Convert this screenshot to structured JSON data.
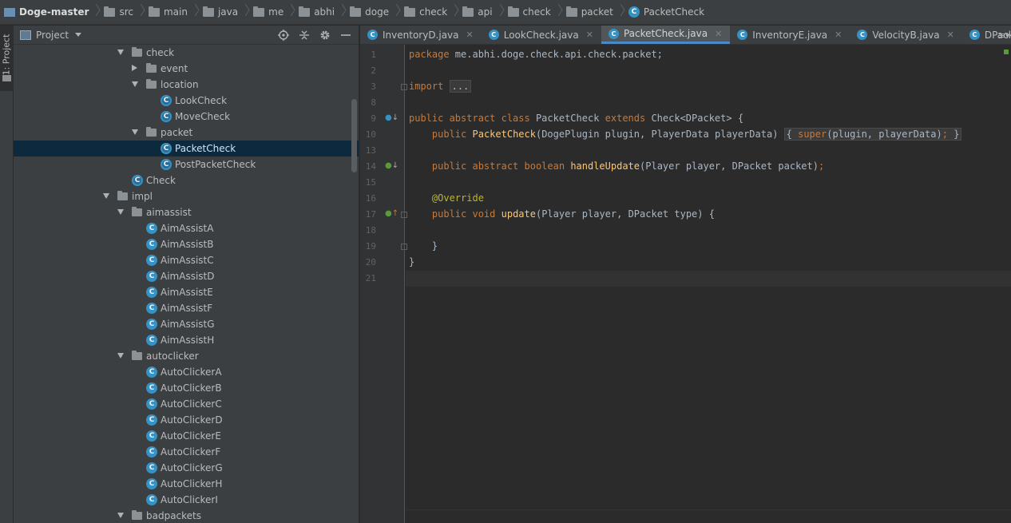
{
  "breadcrumbs": [
    "Doge-master",
    "src",
    "main",
    "java",
    "me",
    "abhi",
    "doge",
    "check",
    "api",
    "check",
    "packet",
    "PacketCheck"
  ],
  "stripe": {
    "tab_label": "1: Project"
  },
  "project_panel": {
    "title": "Project"
  },
  "tree": [
    {
      "label": "check",
      "depth": 2,
      "type": "folder",
      "expanded": true
    },
    {
      "label": "event",
      "depth": 3,
      "type": "folder",
      "expanded": false
    },
    {
      "label": "location",
      "depth": 3,
      "type": "folder",
      "expanded": true
    },
    {
      "label": "LookCheck",
      "depth": 4,
      "type": "abstract-class"
    },
    {
      "label": "MoveCheck",
      "depth": 4,
      "type": "abstract-class"
    },
    {
      "label": "packet",
      "depth": 3,
      "type": "folder",
      "expanded": true
    },
    {
      "label": "PacketCheck",
      "depth": 4,
      "type": "abstract-class",
      "selected": true
    },
    {
      "label": "PostPacketCheck",
      "depth": 4,
      "type": "abstract-class"
    },
    {
      "label": "Check",
      "depth": 2,
      "type": "abstract-class"
    },
    {
      "label": "impl",
      "depth": 1,
      "type": "folder",
      "expanded": true
    },
    {
      "label": "aimassist",
      "depth": 2,
      "type": "folder",
      "expanded": true
    },
    {
      "label": "AimAssistA",
      "depth": 3,
      "type": "class"
    },
    {
      "label": "AimAssistB",
      "depth": 3,
      "type": "class"
    },
    {
      "label": "AimAssistC",
      "depth": 3,
      "type": "class"
    },
    {
      "label": "AimAssistD",
      "depth": 3,
      "type": "class"
    },
    {
      "label": "AimAssistE",
      "depth": 3,
      "type": "class"
    },
    {
      "label": "AimAssistF",
      "depth": 3,
      "type": "class"
    },
    {
      "label": "AimAssistG",
      "depth": 3,
      "type": "class"
    },
    {
      "label": "AimAssistH",
      "depth": 3,
      "type": "class"
    },
    {
      "label": "autoclicker",
      "depth": 2,
      "type": "folder",
      "expanded": true
    },
    {
      "label": "AutoClickerA",
      "depth": 3,
      "type": "class"
    },
    {
      "label": "AutoClickerB",
      "depth": 3,
      "type": "class"
    },
    {
      "label": "AutoClickerC",
      "depth": 3,
      "type": "class"
    },
    {
      "label": "AutoClickerD",
      "depth": 3,
      "type": "class"
    },
    {
      "label": "AutoClickerE",
      "depth": 3,
      "type": "class"
    },
    {
      "label": "AutoClickerF",
      "depth": 3,
      "type": "class"
    },
    {
      "label": "AutoClickerG",
      "depth": 3,
      "type": "class"
    },
    {
      "label": "AutoClickerH",
      "depth": 3,
      "type": "class"
    },
    {
      "label": "AutoClickerI",
      "depth": 3,
      "type": "class"
    },
    {
      "label": "badpackets",
      "depth": 2,
      "type": "folder",
      "expanded": true
    }
  ],
  "tabs": [
    {
      "label": "InventoryD.java",
      "active": false
    },
    {
      "label": "LookCheck.java",
      "active": false
    },
    {
      "label": "PacketCheck.java",
      "active": true
    },
    {
      "label": "InventoryE.java",
      "active": false
    },
    {
      "label": "VelocityB.java",
      "active": false
    },
    {
      "label": "DPacketPlayInE",
      "active": false
    }
  ],
  "code_lines": [
    {
      "n": "1",
      "html": "<span class=\"kw\">package</span> me.abhi.doge.check.api.check.packet;"
    },
    {
      "n": "2",
      "html": ""
    },
    {
      "n": "3",
      "html": "<span class=\"kw\">import</span> <span class=\"fold-box\">...</span>"
    },
    {
      "n": "8",
      "html": ""
    },
    {
      "n": "9",
      "html": "<span class=\"kw\">public abstract class</span> PacketCheck <span class=\"kw\">extends</span> Check&lt;DPacket&gt; {"
    },
    {
      "n": "10",
      "html": "    <span class=\"kw\">public</span> <span class=\"fn\">PacketCheck</span>(DogePlugin plugin, PlayerData playerData) <span class=\"fold-box\">{ <span class=\"kw\">super</span>(plugin, playerData)<span class=\"kw\">;</span> }</span>"
    },
    {
      "n": "13",
      "html": ""
    },
    {
      "n": "14",
      "html": "    <span class=\"kw\">public abstract boolean</span> <span class=\"fn\">handleUpdate</span>(Player player, DPacket packet)<span class=\"kw\">;</span>"
    },
    {
      "n": "15",
      "html": ""
    },
    {
      "n": "16",
      "html": "    <span class=\"ann\">@Override</span>"
    },
    {
      "n": "17",
      "html": "    <span class=\"kw\">public void</span> <span class=\"fn\">update</span>(Player player, DPacket type) {"
    },
    {
      "n": "18",
      "html": ""
    },
    {
      "n": "19",
      "html": "    }"
    },
    {
      "n": "20",
      "html": "}"
    },
    {
      "n": "21",
      "html": ""
    }
  ],
  "colors": {
    "accent": "#4a88c7",
    "selection": "#0d293e",
    "keyword": "#cc7832",
    "function": "#ffc66d",
    "annotation": "#bbb529",
    "class_icon": "#3592c4"
  }
}
